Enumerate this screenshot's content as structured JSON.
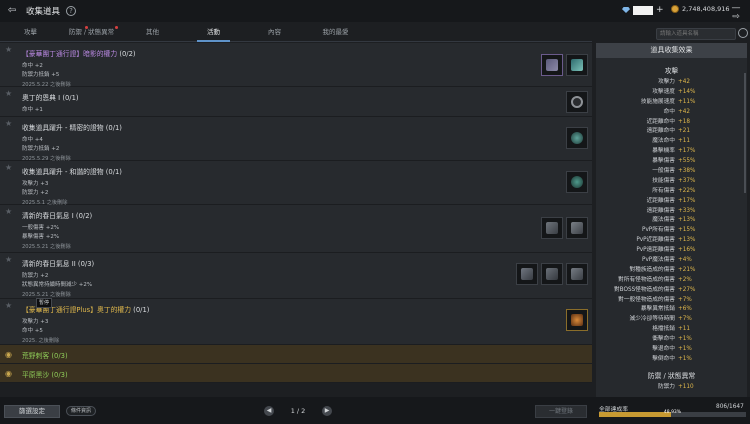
{
  "window": {
    "title": "收集道具",
    "gems": "",
    "gold": "2,748,408,916"
  },
  "tabs": [
    {
      "label": "攻擊"
    },
    {
      "label": "防禦 / 狀態異常"
    },
    {
      "label": "其他"
    },
    {
      "label": "活動"
    },
    {
      "label": "內容"
    },
    {
      "label": "我的最愛"
    }
  ],
  "search": {
    "placeholder": "請輸入道具名稱"
  },
  "collections": [
    {
      "prefix": "【豪華團丁通行證】",
      "name": "暗影的權力",
      "count": "(0/2)",
      "stats": [
        "命中 +2",
        "防禦力抵銷 +5"
      ],
      "date": "2025.5.22 之後刪除"
    },
    {
      "prefix": "",
      "name": "奧丁的恩典 I",
      "count": "(0/1)",
      "stats": [
        "命中 +1"
      ],
      "date": ""
    },
    {
      "prefix": "",
      "name": "收集道具躍升 - 精密的證物",
      "count": "(0/1)",
      "stats": [
        "命中 +4",
        "防禦力抵銷 +2"
      ],
      "date": "2025.5.29 之後刪除"
    },
    {
      "prefix": "",
      "name": "收集道具躍升 - 和諧的證物",
      "count": "(0/1)",
      "stats": [
        "攻擊力 +3",
        "防禦力 +2"
      ],
      "date": "2025.5.1 之後刪除"
    },
    {
      "prefix": "",
      "name": "清新的春日氣息 I",
      "count": "(0/2)",
      "stats": [
        "一般傷害 +2%",
        "暴擊傷害 +2%"
      ],
      "date": "2025.5.21 之後刪除"
    },
    {
      "prefix": "",
      "name": "清新的春日氣息 II",
      "count": "(0/3)",
      "stats": [
        "防禦力 +2",
        "狀態異常持續時間減少 +2%"
      ],
      "date": "2025.5.21 之後刪除"
    },
    {
      "prefix": "【豪華團丁通行證Plus】",
      "name": "奧丁的權力",
      "count": "(0/1)",
      "stats": [
        "攻擊力 +3",
        "命中 +5"
      ],
      "date": "2025.  之後刪除"
    }
  ],
  "tooltip": "暫停",
  "completed": [
    {
      "label": "荒野刺客 (0/3)"
    },
    {
      "label": "平原黑沙 (0/3)"
    }
  ],
  "panel": {
    "title": "道具收集效果",
    "section_attack": "攻擊",
    "stats": [
      {
        "k": "攻擊力",
        "v": "+42"
      },
      {
        "k": "攻擊速度",
        "v": "+14%"
      },
      {
        "k": "技能施展速度",
        "v": "+11%"
      },
      {
        "k": "命中",
        "v": "+42"
      },
      {
        "k": "近距離命中",
        "v": "+18"
      },
      {
        "k": "遠距離命中",
        "v": "+21"
      },
      {
        "k": "魔法命中",
        "v": "+11"
      },
      {
        "k": "暴擊機率",
        "v": "+17%"
      },
      {
        "k": "暴擊傷害",
        "v": "+55%"
      },
      {
        "k": "一般傷害",
        "v": "+38%"
      },
      {
        "k": "技能傷害",
        "v": "+37%"
      },
      {
        "k": "所有傷害",
        "v": "+22%"
      },
      {
        "k": "近距離傷害",
        "v": "+17%"
      },
      {
        "k": "遠距離傷害",
        "v": "+33%"
      },
      {
        "k": "魔法傷害",
        "v": "+13%"
      },
      {
        "k": "PvP所有傷害",
        "v": "+15%"
      },
      {
        "k": "PvP近距離傷害",
        "v": "+13%"
      },
      {
        "k": "PvP遠距離傷害",
        "v": "+16%"
      },
      {
        "k": "PvP魔法傷害",
        "v": "+4%"
      },
      {
        "k": "對種族造成的傷害",
        "v": "+21%"
      },
      {
        "k": "對所有怪物造成的傷害",
        "v": "+2%"
      },
      {
        "k": "對BOSS怪物造成的傷害",
        "v": "+27%"
      },
      {
        "k": "對一般怪物造成的傷害",
        "v": "+7%"
      },
      {
        "k": "暴擊異常抵銷",
        "v": "+6%"
      },
      {
        "k": "減少冷卻等待時間",
        "v": "+7%"
      },
      {
        "k": "格擋抵銷",
        "v": "+11"
      },
      {
        "k": "衝擊命中",
        "v": "+1%"
      },
      {
        "k": "擊退命中",
        "v": "+1%"
      },
      {
        "k": "擊倒命中",
        "v": "+1%"
      }
    ],
    "section_defense": "防禦 / 狀態異常",
    "cut_stat": {
      "k": "防禦力",
      "v": "+110"
    }
  },
  "bottom": {
    "filter_label": "篩選設定",
    "condition_label": "條件資訊",
    "page": "1 / 2",
    "register_label": "一鍵登錄",
    "progress_label": "全部達成率",
    "progress_count": "806/1647",
    "progress_pct": "48.93%",
    "progress_value": 0.4893
  }
}
